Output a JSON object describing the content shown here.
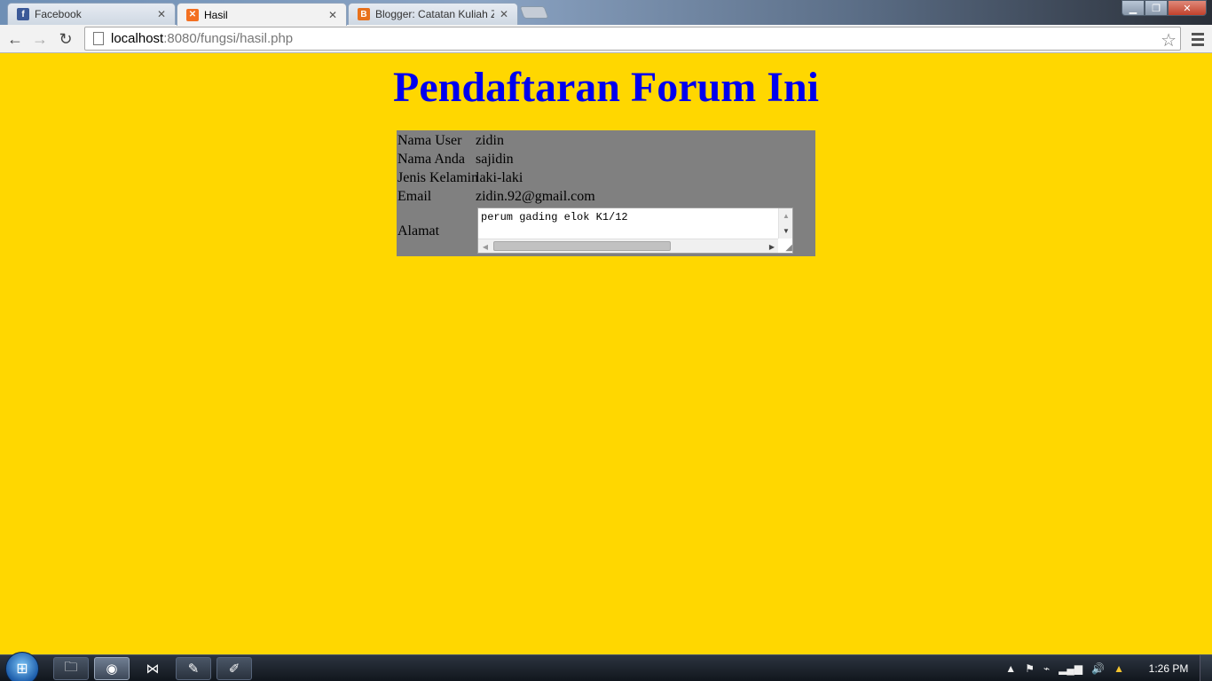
{
  "browser": {
    "tabs": [
      {
        "label": "Facebook",
        "icon": "facebook-icon",
        "active": false
      },
      {
        "label": "Hasil",
        "icon": "xampp-icon",
        "active": true
      },
      {
        "label": "Blogger: Catatan Kuliah Zi",
        "icon": "blogger-icon",
        "active": false
      }
    ],
    "url_host": "localhost",
    "url_rest": ":8080/fungsi/hasil.php"
  },
  "page": {
    "title": "Pendaftaran Forum Ini",
    "rows": [
      {
        "label": "Nama User",
        "value": "zidin"
      },
      {
        "label": "Nama Anda",
        "value": "sajidin"
      },
      {
        "label": "Jenis Kelamin",
        "value": "laki-laki"
      },
      {
        "label": "Email",
        "value": "zidin.92@gmail.com"
      }
    ],
    "alamat_label": "Alamat",
    "alamat_value": "perum gading elok K1/12"
  },
  "colors": {
    "page_background": "#ffd700",
    "title_color": "#0000ee",
    "table_background": "#808080"
  },
  "taskbar": {
    "apps": [
      "explorer-icon",
      "chrome-icon",
      "visual-studio-icon",
      "notepad-icon",
      "paint-icon"
    ],
    "clock": "1:26 PM"
  }
}
